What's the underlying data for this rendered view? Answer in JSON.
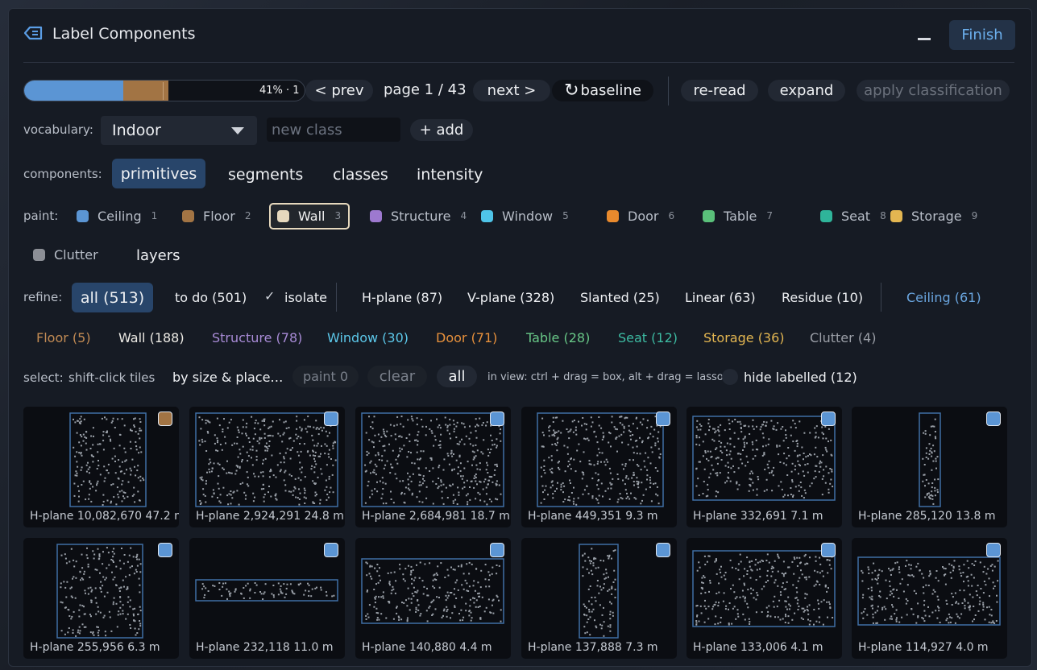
{
  "title": "Label Components",
  "finish_label": "Finish",
  "colors": {
    "accent": "#6cb0ee",
    "active_button": "#28456a",
    "ceiling": "#5b95d4",
    "floor": "#a27444"
  },
  "progress": {
    "text": "41% · 1",
    "ceiling_fraction": 0.35,
    "floor_fraction": 0.41
  },
  "toolbar": {
    "prev": "< prev",
    "page": "page 1 / 43",
    "next": "next >",
    "baseline": "baseline",
    "baseline_icon": "refresh-icon",
    "reread": "re-read",
    "expand": "expand",
    "apply": "apply classification"
  },
  "vocabulary": {
    "label": "vocabulary:",
    "selected": "Indoor",
    "new_class_placeholder": "new class",
    "add": "+ add"
  },
  "components": {
    "label": "components:",
    "tabs": [
      "primitives",
      "segments",
      "classes",
      "intensity"
    ],
    "active": "primitives"
  },
  "paint": {
    "label": "paint:",
    "classes": [
      {
        "name": "Ceiling",
        "key": "1",
        "color": "#5b95d4"
      },
      {
        "name": "Floor",
        "key": "2",
        "color": "#a27444"
      },
      {
        "name": "Wall",
        "key": "3",
        "color": "#e6d8bd"
      },
      {
        "name": "Structure",
        "key": "4",
        "color": "#9d79cf"
      },
      {
        "name": "Window",
        "key": "5",
        "color": "#4fc4e8"
      },
      {
        "name": "Door",
        "key": "6",
        "color": "#e98a2d"
      },
      {
        "name": "Table",
        "key": "7",
        "color": "#5ac07a"
      },
      {
        "name": "Seat",
        "key": "8",
        "color": "#2fb49a"
      },
      {
        "name": "Storage",
        "key": "9",
        "color": "#e3b651"
      },
      {
        "name": "Clutter",
        "key": "",
        "color": "#8c8f96"
      }
    ],
    "selected": "Wall",
    "layers": "layers"
  },
  "refine": {
    "label": "refine:",
    "all": "all (513)",
    "todo": "to do (501)",
    "isolate": "isolate",
    "planes": [
      "H-plane (87)",
      "V-plane (328)",
      "Slanted (25)",
      "Linear (63)",
      "Residue (10)"
    ],
    "classes": [
      {
        "text": "Ceiling (61)",
        "color": "#6aa6e0"
      },
      {
        "text": "Floor (5)",
        "color": "#c28b54"
      },
      {
        "text": "Wall (188)",
        "color": "#eceae4"
      },
      {
        "text": "Structure (78)",
        "color": "#a88bd6"
      },
      {
        "text": "Window (30)",
        "color": "#5cc8ea"
      },
      {
        "text": "Door (71)",
        "color": "#e8913c"
      },
      {
        "text": "Table (28)",
        "color": "#68c787"
      },
      {
        "text": "Seat (12)",
        "color": "#3dbba2"
      },
      {
        "text": "Storage (36)",
        "color": "#e3b651"
      },
      {
        "text": "Clutter (4)",
        "color": "#9b9fa7"
      }
    ]
  },
  "select": {
    "label": "select:",
    "shift": "shift-click tiles",
    "by_size": "by size & place…",
    "paint": "paint 0",
    "clear": "clear",
    "all": "all",
    "hint": "in view: ctrl + drag = box, alt + drag = lasso",
    "hide_labelled": "hide labelled (12)"
  },
  "tiles": [
    {
      "label": "H-plane  10,082,670  47.2 m",
      "class_color": "#a27444"
    },
    {
      "label": "H-plane  2,924,291  24.8 m",
      "class_color": "#5b95d4"
    },
    {
      "label": "H-plane  2,684,981  18.7 m",
      "class_color": "#5b95d4"
    },
    {
      "label": "H-plane  449,351  9.3 m",
      "class_color": "#5b95d4"
    },
    {
      "label": "H-plane  332,691  7.1 m",
      "class_color": "#5b95d4"
    },
    {
      "label": "H-plane  285,120  13.8 m",
      "class_color": "#5b95d4"
    },
    {
      "label": "H-plane  255,956  6.3 m",
      "class_color": "#5b95d4"
    },
    {
      "label": "H-plane  232,118  11.0 m",
      "class_color": "#5b95d4"
    },
    {
      "label": "H-plane  140,880  4.4 m",
      "class_color": "#5b95d4"
    },
    {
      "label": "H-plane  137,888  7.3 m",
      "class_color": "#5b95d4"
    },
    {
      "label": "H-plane  133,006  4.1 m",
      "class_color": "#5b95d4"
    },
    {
      "label": "H-plane  114,927  4.0 m",
      "class_color": "#5b95d4"
    }
  ]
}
